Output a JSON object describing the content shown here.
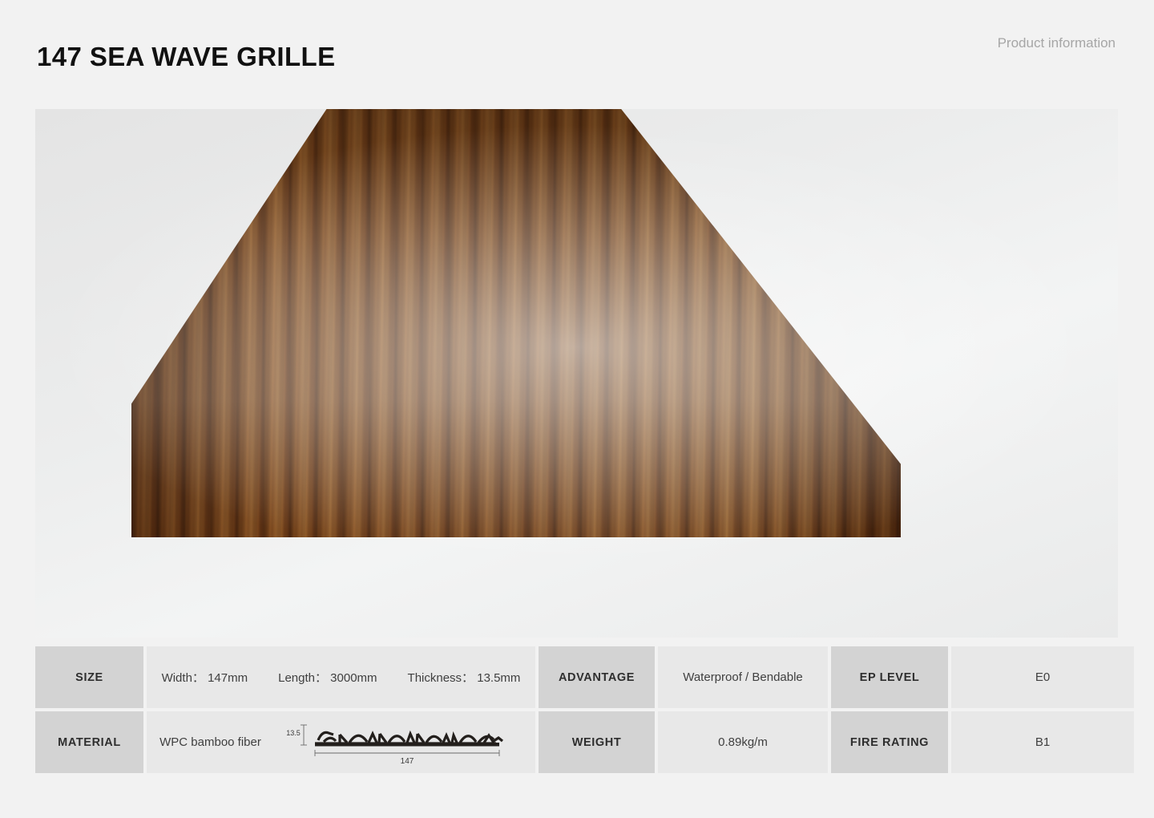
{
  "header": {
    "title": "147 SEA WAVE GRILLE",
    "note": "Product information"
  },
  "product_image": {
    "alt_name": "wpc-sea-wave-grille-panel",
    "wood_tone_hex": "#a87f51",
    "core_color_hex": "#efe7cf",
    "background_hex": "#ecedee"
  },
  "spec_table": {
    "rows": [
      {
        "cells": [
          {
            "kind": "label",
            "text": "SIZE"
          },
          {
            "kind": "value",
            "type": "size",
            "text": "Width： 147mm    Length： 3000mm    Thickness： 13.5mm"
          },
          {
            "kind": "label",
            "text": "ADVANTAGE"
          },
          {
            "kind": "value",
            "text": "Waterproof / Bendable"
          },
          {
            "kind": "label",
            "text": "EP LEVEL"
          },
          {
            "kind": "value",
            "text": "E0"
          }
        ]
      },
      {
        "cells": [
          {
            "kind": "label",
            "text": "MATERIAL"
          },
          {
            "kind": "value",
            "type": "material",
            "text": "WPC bamboo fiber"
          },
          {
            "kind": "label",
            "text": "WEIGHT"
          },
          {
            "kind": "value",
            "text": "0.89kg/m"
          },
          {
            "kind": "label",
            "text": "FIRE RATING"
          },
          {
            "kind": "value",
            "text": "B1"
          }
        ]
      }
    ],
    "size_fields": [
      {
        "label": "Width：",
        "value": "147mm"
      },
      {
        "label": "Length：",
        "value": "3000mm"
      },
      {
        "label": "Thickness：",
        "value": "13.5mm"
      }
    ],
    "labels": {
      "size": "SIZE",
      "material": "MATERIAL",
      "advantage": "ADVANTAGE",
      "weight": "WEIGHT",
      "ep_level": "EP LEVEL",
      "fire_rating": "FIRE RATING"
    },
    "values": {
      "advantage": "Waterproof / Bendable",
      "weight": "0.89kg/m",
      "ep_level": "E0",
      "fire_rating": "B1",
      "material": "WPC bamboo fiber"
    }
  },
  "profile_diagram": {
    "height_dimension": "13.5",
    "width_dimension": "147",
    "units": "mm"
  }
}
